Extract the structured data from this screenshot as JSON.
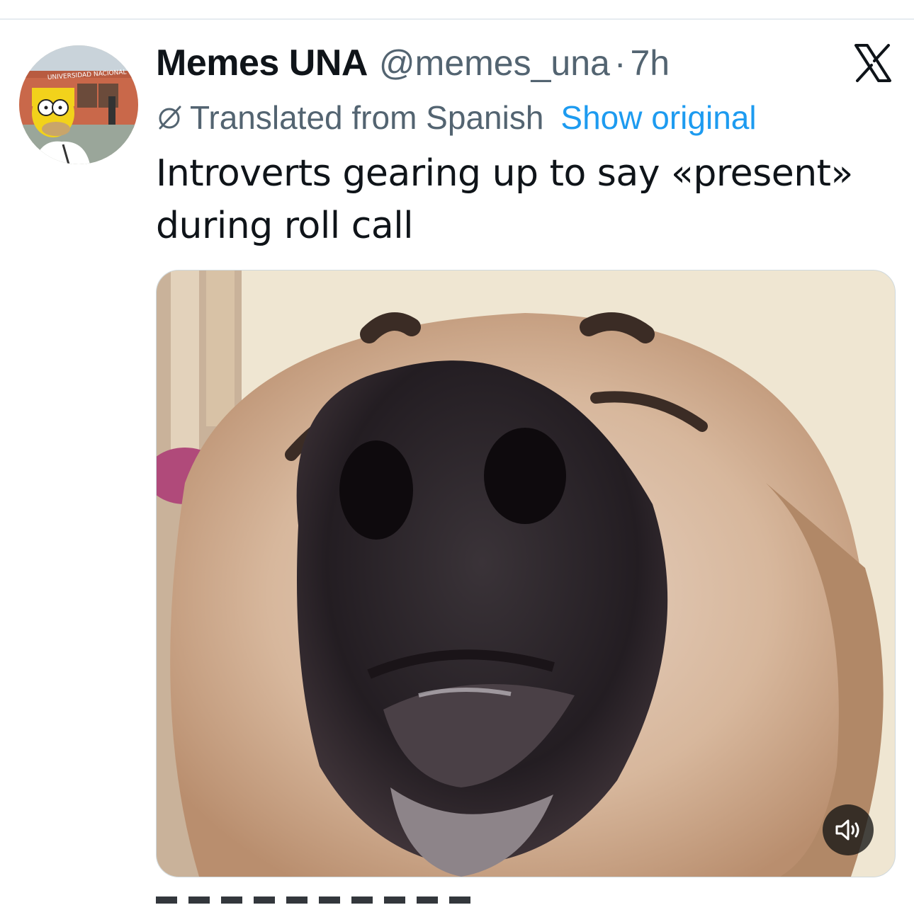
{
  "tweet": {
    "display_name": "Memes UNA",
    "handle": "@memes_una",
    "separator": "·",
    "time": "7h",
    "translation_label": "Translated from Spanish",
    "show_original_label": "Show original",
    "text_lines": [
      "Introverts gearing up to say «present»",
      "during roll call"
    ]
  },
  "icons": {
    "close": "x-logo-icon",
    "translate": "translate-icon",
    "volume": "volume-icon"
  },
  "colors": {
    "text": "#0f1419",
    "secondary": "#536471",
    "link": "#1d9bf0"
  }
}
